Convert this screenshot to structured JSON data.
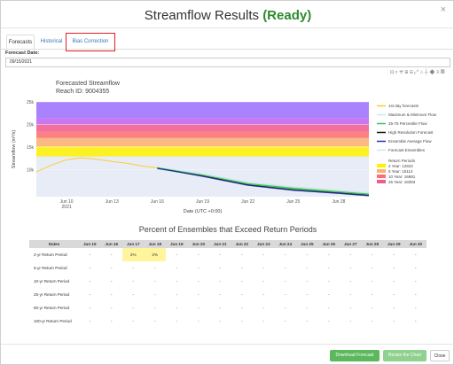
{
  "modal": {
    "title_prefix": "Streamflow Results",
    "title_status": "(Ready)",
    "close_glyph": "×"
  },
  "tabs": [
    {
      "label": "Forecasts",
      "active": true
    },
    {
      "label": "Historical",
      "active": false
    },
    {
      "label": "Bias Correction",
      "active": false
    }
  ],
  "forecast_date": {
    "label": "Forecast Date:",
    "value": "09/15/2021"
  },
  "chart_toolbar": {
    "icons": [
      "camera-icon",
      "zoom-icon",
      "pan-icon",
      "zoom-in-icon",
      "zoom-out-icon",
      "autoscale-icon",
      "reset-axes-icon",
      "spike-lines-icon",
      "hover-closest-icon",
      "hover-compare-icon",
      "plotly-logo-icon"
    ]
  },
  "chart_data": {
    "type": "line",
    "title": "Forecasted Streamflow",
    "subtitle": "Reach ID: 9004355",
    "xlabel": "Date (UTC +0:00)",
    "ylabel": "Streamflow (m³/s)",
    "x_ticks": [
      "Jun 10\n2021",
      "Jun 13",
      "Jun 16",
      "Jun 19",
      "Jun 22",
      "Jun 25",
      "Jun 28"
    ],
    "x_range": [
      "2021-06-08",
      "2021-06-30"
    ],
    "y_ticks": [
      "10k",
      "15k",
      "20k",
      "25k"
    ],
    "y_range": [
      4000,
      25000
    ],
    "return_period_bands": [
      {
        "name": "2 Year",
        "value": 12922,
        "color": "#fff200"
      },
      {
        "name": "5 Year",
        "value": 15112,
        "color": "#ffb070"
      },
      {
        "name": "10 Year",
        "value": 16981,
        "color": "#ff6f6f"
      },
      {
        "name": "25 Year",
        "value": 18393,
        "color": "#f45a8d"
      },
      {
        "name": "50 Year",
        "value": 19917,
        "color": "#c263ef"
      },
      {
        "name": "100 Year",
        "value": 21321,
        "color": "#a070ff"
      }
    ],
    "series": [
      {
        "name": "1st day forecasts",
        "color": "#ffcc33",
        "x": [
          "2021-06-08",
          "2021-06-09",
          "2021-06-10",
          "2021-06-11",
          "2021-06-12",
          "2021-06-13",
          "2021-06-14",
          "2021-06-15",
          "2021-06-16"
        ],
        "y": [
          9500,
          11000,
          12200,
          12600,
          12300,
          11800,
          11400,
          10800,
          10400
        ]
      },
      {
        "name": "Maximum & Minimum Flow",
        "color": "#c9e8ec",
        "x": [
          "2021-06-16",
          "2021-06-19",
          "2021-06-22",
          "2021-06-25",
          "2021-06-28",
          "2021-06-30"
        ],
        "y": [
          10300,
          8900,
          7000,
          6000,
          5200,
          4700
        ]
      },
      {
        "name": "25-75 Percentile Flow",
        "color": "#46c25a",
        "x": [
          "2021-06-16",
          "2021-06-19",
          "2021-06-22",
          "2021-06-25",
          "2021-06-28",
          "2021-06-30"
        ],
        "y": [
          10300,
          8700,
          6800,
          5800,
          5000,
          4500
        ]
      },
      {
        "name": "High Resolution Forecast",
        "color": "#111111",
        "x": [
          "2021-06-16",
          "2021-06-19",
          "2021-06-22",
          "2021-06-25",
          "2021-06-28",
          "2021-06-30"
        ],
        "y": [
          10300,
          8600,
          6600,
          5500,
          4800,
          4300
        ]
      },
      {
        "name": "Ensemble Average Flow",
        "color": "#2c2cb8",
        "x": [
          "2021-06-16",
          "2021-06-19",
          "2021-06-22",
          "2021-06-25",
          "2021-06-28",
          "2021-06-30"
        ],
        "y": [
          10300,
          8500,
          6500,
          5400,
          4700,
          4200
        ]
      }
    ],
    "legend": [
      {
        "label": "1st day forecasts",
        "color": "#ffcc33",
        "kind": "line"
      },
      {
        "label": "Maximum & Minimum Flow",
        "color": "#c9e8ec",
        "kind": "line"
      },
      {
        "label": "25-75 Percentile Flow",
        "color": "#46c25a",
        "kind": "line"
      },
      {
        "label": "High Resolution Forecast",
        "color": "#111111",
        "kind": "line"
      },
      {
        "label": "Ensemble Average Flow",
        "color": "#2c2cb8",
        "kind": "line"
      },
      {
        "label": "Forecast Ensembles",
        "color": "#c9e8ec",
        "kind": "line"
      },
      {
        "label": "Return Periods",
        "color": "",
        "kind": "header"
      },
      {
        "label": "2 Year: 12922",
        "color": "#fff200",
        "kind": "swatch"
      },
      {
        "label": "5 Year: 15112",
        "color": "#ffb070",
        "kind": "swatch"
      },
      {
        "label": "10 Year: 16981",
        "color": "#ff6f6f",
        "kind": "swatch"
      },
      {
        "label": "25 Year: 18393",
        "color": "#f45a8d",
        "kind": "swatch"
      }
    ]
  },
  "exceed_table": {
    "title": "Percent of Ensembles that Exceed Return Periods",
    "headers": [
      "Dates",
      "Jun 15",
      "Jun 16",
      "Jun 17",
      "Jun 18",
      "Jun 19",
      "Jun 20",
      "Jun 21",
      "Jun 22",
      "Jun 23",
      "Jun 24",
      "Jun 25",
      "Jun 26",
      "Jun 27",
      "Jun 28",
      "Jun 29",
      "Jun 30"
    ],
    "rows": [
      {
        "label": "2-yr Return Period",
        "cells": [
          "-",
          "-",
          "2%",
          "2%",
          "-",
          "-",
          "-",
          "-",
          "-",
          "-",
          "-",
          "-",
          "-",
          "-",
          "-",
          "-"
        ]
      },
      {
        "label": "5-yr Return Period",
        "cells": [
          "-",
          "-",
          "-",
          "-",
          "-",
          "-",
          "-",
          "-",
          "-",
          "-",
          "-",
          "-",
          "-",
          "-",
          "-",
          "-"
        ]
      },
      {
        "label": "10-yr Return Period",
        "cells": [
          "-",
          "-",
          "-",
          "-",
          "-",
          "-",
          "-",
          "-",
          "-",
          "-",
          "-",
          "-",
          "-",
          "-",
          "-",
          "-"
        ]
      },
      {
        "label": "25-yr Return Period",
        "cells": [
          "-",
          "-",
          "-",
          "-",
          "-",
          "-",
          "-",
          "-",
          "-",
          "-",
          "-",
          "-",
          "-",
          "-",
          "-",
          "-"
        ]
      },
      {
        "label": "50-yr Return Period",
        "cells": [
          "-",
          "-",
          "-",
          "-",
          "-",
          "-",
          "-",
          "-",
          "-",
          "-",
          "-",
          "-",
          "-",
          "-",
          "-",
          "-"
        ]
      },
      {
        "label": "100-yr Return Period",
        "cells": [
          "-",
          "-",
          "-",
          "-",
          "-",
          "-",
          "-",
          "-",
          "-",
          "-",
          "-",
          "-",
          "-",
          "-",
          "-",
          "-"
        ]
      }
    ],
    "highlight_color": "#fff59d"
  },
  "footer": {
    "download_label": "Download Forecast",
    "resize_label": "Resize the Chart",
    "close_label": "Close"
  }
}
